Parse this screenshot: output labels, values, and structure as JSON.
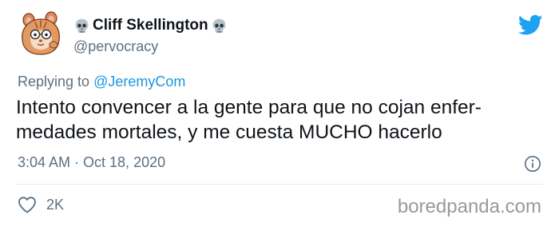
{
  "author": {
    "display_name": "Cliff Skellington",
    "handle": "@pervocracy",
    "name_prefix_icon": "skull-emoji",
    "name_suffix_icon": "skull-emoji"
  },
  "reply": {
    "prefix": "Replying to ",
    "mention": "@JeremyCom"
  },
  "tweet": {
    "text_line_1": "Intento convencer a la gente para que no cojan enfer-",
    "text_line_2": "medades mortales, y me cuesta MUCHO hacerlo"
  },
  "meta": {
    "timestamp": "3:04 AM · Oct 18, 2020"
  },
  "actions": {
    "like_count": "2K"
  },
  "watermark": "boredpanda.com",
  "colors": {
    "text": "#0f1419",
    "secondary": "#5b7083",
    "link": "#1b95e0",
    "twitter_blue": "#1da1f2"
  }
}
